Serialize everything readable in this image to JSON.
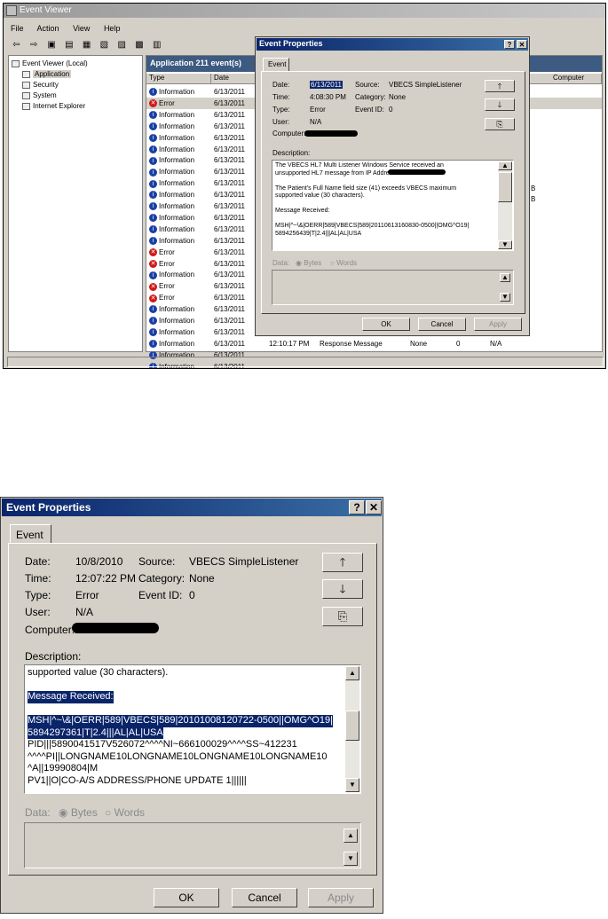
{
  "top": {
    "window_title": "Event Viewer",
    "menu": [
      "File",
      "Action",
      "View",
      "Help"
    ],
    "tree": [
      "Event Viewer (Local)",
      "Application",
      "Security",
      "System",
      "Internet Explorer"
    ],
    "list_header": "Application  211 event(s)",
    "columns": [
      "Type",
      "Date",
      "Computer"
    ],
    "rows": [
      {
        "type": "Information",
        "date": "6/13/2011",
        "icon": "info"
      },
      {
        "type": "Error",
        "date": "6/13/2011",
        "icon": "error"
      },
      {
        "type": "Information",
        "date": "6/13/2011",
        "icon": "info"
      },
      {
        "type": "Information",
        "date": "6/13/2011",
        "icon": "info"
      },
      {
        "type": "Information",
        "date": "6/13/2011",
        "icon": "info"
      },
      {
        "type": "Information",
        "date": "6/13/2011",
        "icon": "info"
      },
      {
        "type": "Information",
        "date": "6/13/2011",
        "icon": "info"
      },
      {
        "type": "Information",
        "date": "6/13/2011",
        "icon": "info"
      },
      {
        "type": "Information",
        "date": "6/13/2011",
        "icon": "info"
      },
      {
        "type": "Information",
        "date": "6/13/2011",
        "icon": "info"
      },
      {
        "type": "Information",
        "date": "6/13/2011",
        "icon": "info"
      },
      {
        "type": "Information",
        "date": "6/13/2011",
        "icon": "info"
      },
      {
        "type": "Information",
        "date": "6/13/2011",
        "icon": "info"
      },
      {
        "type": "Information",
        "date": "6/13/2011",
        "icon": "info"
      },
      {
        "type": "Error",
        "date": "6/13/2011",
        "icon": "error"
      },
      {
        "type": "Error",
        "date": "6/13/2011",
        "icon": "error"
      },
      {
        "type": "Information",
        "date": "6/13/2011",
        "icon": "info"
      },
      {
        "type": "Error",
        "date": "6/13/2011",
        "icon": "error"
      },
      {
        "type": "Error",
        "date": "6/13/2011",
        "icon": "error"
      },
      {
        "type": "Information",
        "date": "6/13/2011",
        "icon": "info"
      },
      {
        "type": "Information",
        "date": "6/13/2011",
        "icon": "info"
      },
      {
        "type": "Information",
        "date": "6/13/2011",
        "icon": "info"
      },
      {
        "type": "Information",
        "date": "6/13/2011",
        "icon": "info"
      },
      {
        "type": "Information",
        "date": "6/13/2011",
        "icon": "info"
      },
      {
        "type": "Information",
        "date": "6/13/2011",
        "icon": "info"
      }
    ],
    "last_row": {
      "time": "12:10:17 PM",
      "source": "Response Message",
      "category": "None",
      "event": "0",
      "user": "N/A"
    },
    "right_fragments": [
      "B",
      "B"
    ]
  },
  "small_dialog": {
    "title": "Event Properties",
    "tab": "Event",
    "date_label": "Date:",
    "date": "6/13/2011",
    "source_label": "Source:",
    "source": "VBECS SimpleListener",
    "time_label": "Time:",
    "time": "4:08:30 PM",
    "category_label": "Category:",
    "category": "None",
    "type_label": "Type:",
    "type": "Error",
    "eventid_label": "Event ID:",
    "eventid": "0",
    "user_label": "User:",
    "user": "N/A",
    "computer_label": "Computer:",
    "description_label": "Description:",
    "description_lines": [
      "The VBECS HL7 Multi Listener Windows Service received an",
      "unsupported HL7 message from IP Address",
      "",
      "The Patient's Full Name field size (41) exceeds VBECS maximum",
      "supported value (30 characters).",
      "",
      "Message Received:",
      "",
      "MSH|^~\\&|OERR|589|VBECS|589|20110613160830-0500||OMG^O19|",
      "5894256439|T|2.4|||AL|AL|USA"
    ],
    "data_label": "Data:",
    "bytes_label": "Bytes",
    "words_label": "Words",
    "ok": "OK",
    "cancel": "Cancel",
    "apply": "Apply"
  },
  "big_dialog": {
    "title": "Event Properties",
    "tab": "Event",
    "date_label": "Date:",
    "date": "10/8/2010",
    "source_label": "Source:",
    "source": "VBECS SimpleListener",
    "time_label": "Time:",
    "time": "12:07:22 PM",
    "category_label": "Category:",
    "category": "None",
    "type_label": "Type:",
    "type": "Error",
    "eventid_label": "Event ID:",
    "eventid": "0",
    "user_label": "User:",
    "user": "N/A",
    "computer_label": "Computer:",
    "description_label": "Description:",
    "description_lines": [
      {
        "text": "supported value (30 characters).",
        "sel": false
      },
      {
        "text": "",
        "sel": false
      },
      {
        "text": "Message Received:",
        "sel": true
      },
      {
        "text": " ",
        "sel": true
      },
      {
        "text": "MSH|^~\\&|OERR|589|VBECS|589|20101008120722-0500||OMG^O19|",
        "sel": true
      },
      {
        "text": "5894297361|T|2.4|||AL|AL|USA",
        "sel": true
      },
      {
        "text": "PID|||5890041517V526072^^^^NI~666100029^^^^SS~412231",
        "sel": false
      },
      {
        "text": "^^^^PI||LONGNAME10LONGNAME10LONGNAME10LONGNAME10",
        "sel": false
      },
      {
        "text": "^A||19990804|M",
        "sel": false
      },
      {
        "text": "PV1||O|CO-A/S ADDRESS/PHONE UPDATE 1||||||",
        "sel": false
      }
    ],
    "data_label": "Data:",
    "bytes_label": "Bytes",
    "words_label": "Words",
    "ok": "OK",
    "cancel": "Cancel",
    "apply": "Apply"
  }
}
